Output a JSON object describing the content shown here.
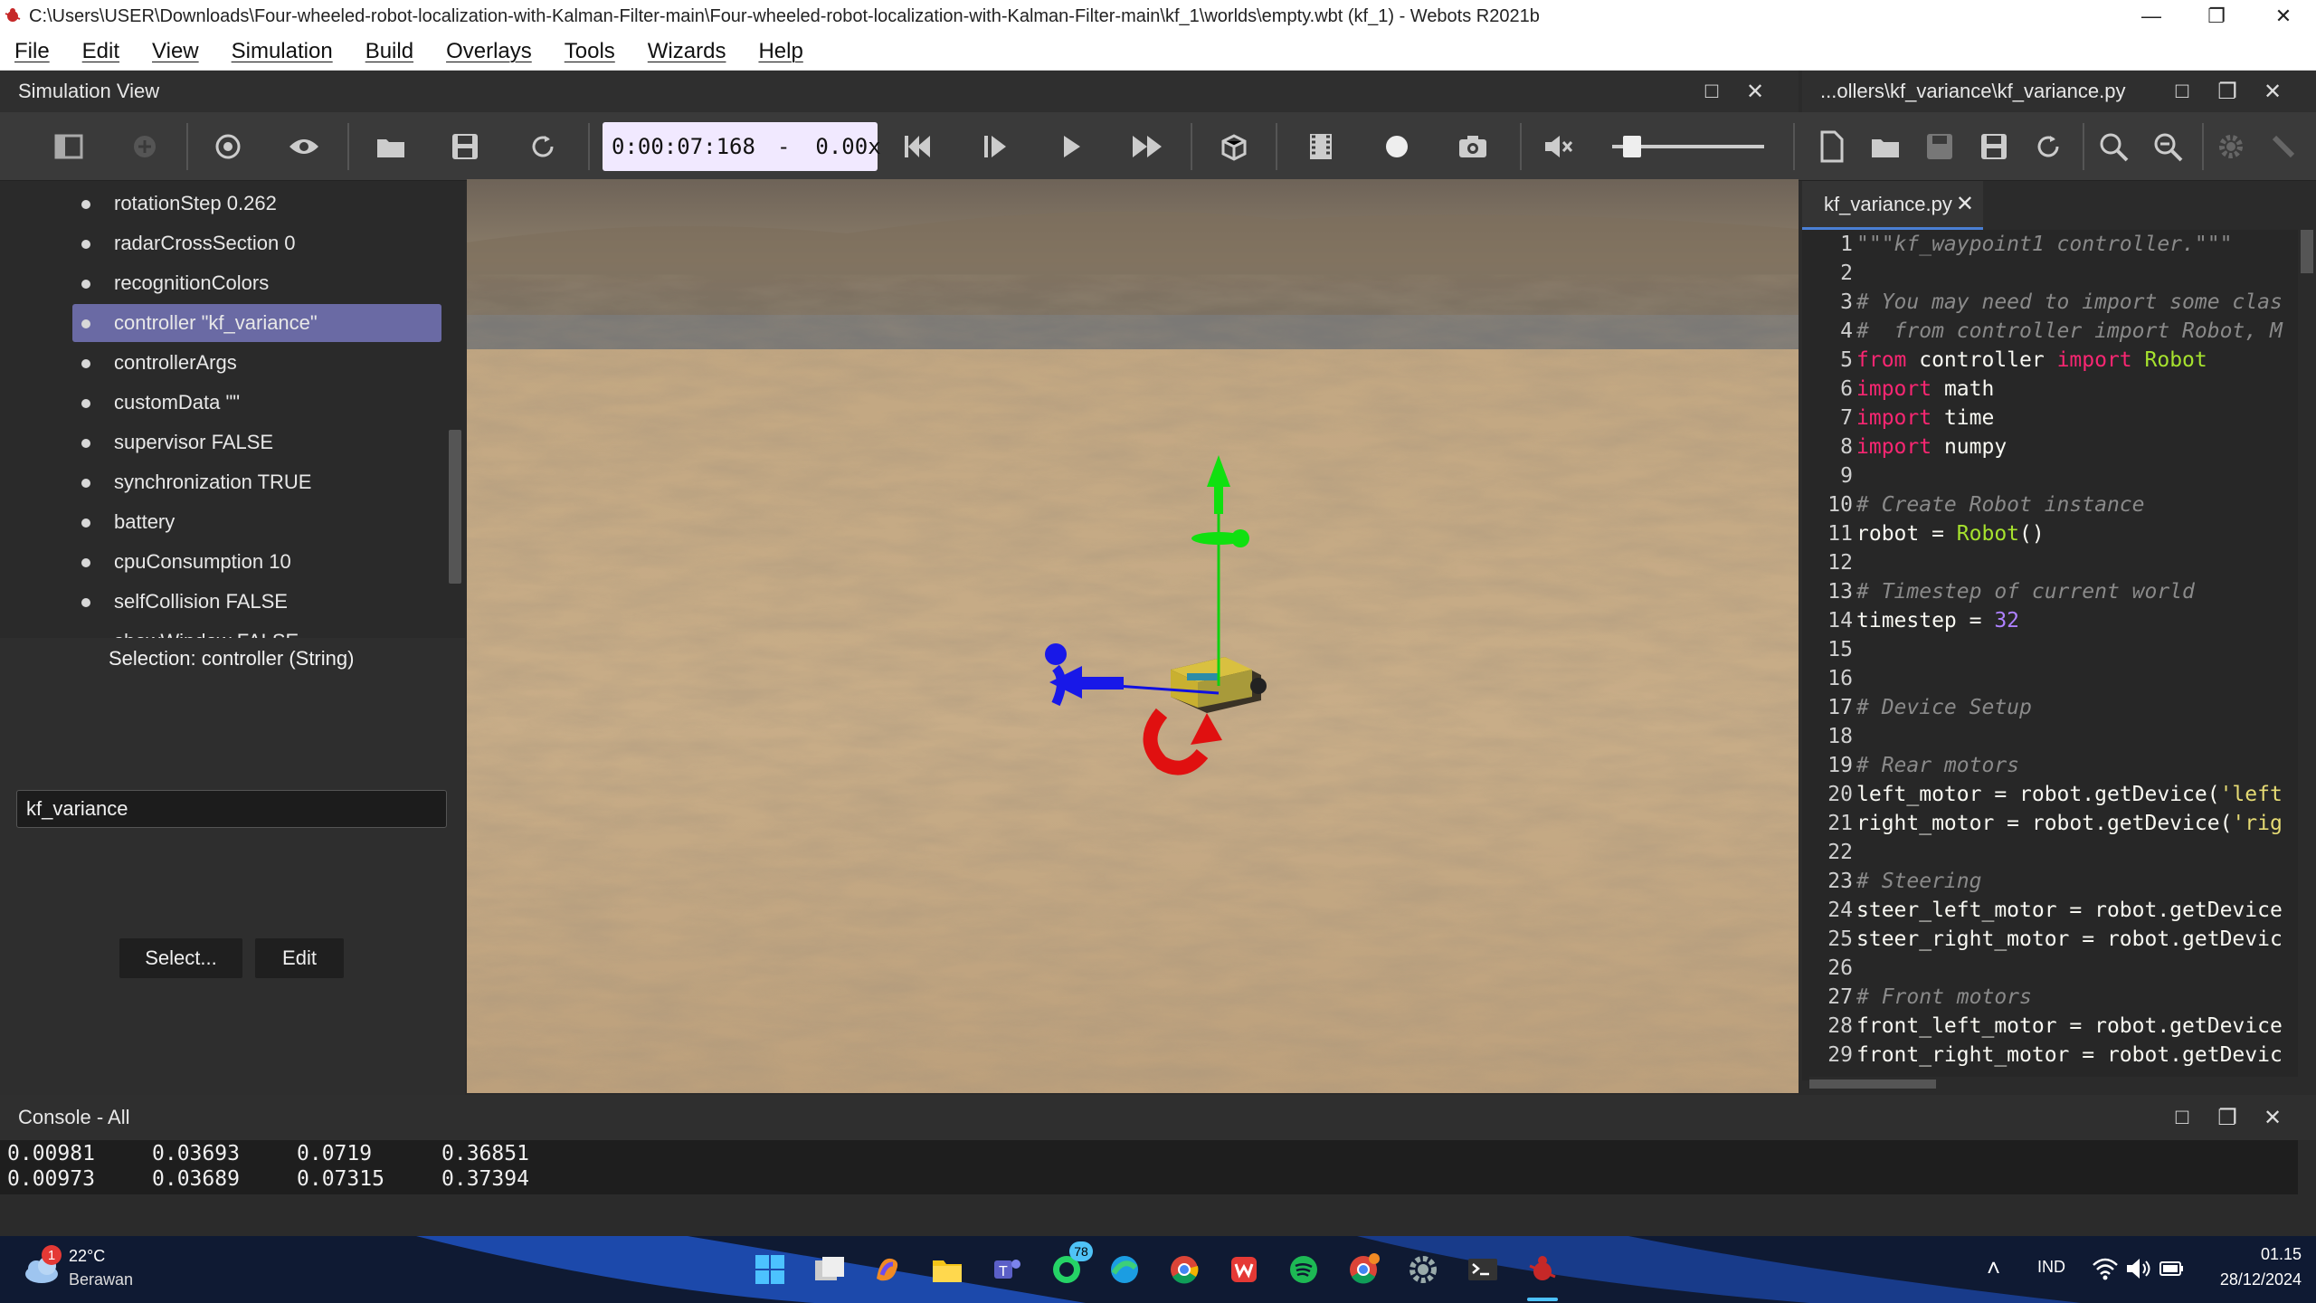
{
  "window": {
    "title": "C:\\Users\\USER\\Downloads\\Four-wheeled-robot-localization-with-Kalman-Filter-main\\Four-wheeled-robot-localization-with-Kalman-Filter-main\\kf_1\\worlds\\empty.wbt (kf_1) - Webots R2021b"
  },
  "menu": [
    "File",
    "Edit",
    "View",
    "Simulation",
    "Build",
    "Overlays",
    "Tools",
    "Wizards",
    "Help"
  ],
  "simulation_view": {
    "title": "Simulation View",
    "time": "0:00:07:168",
    "speed_sep": "-",
    "speed": "0.00x",
    "volume_fraction": 0.08
  },
  "scene_tree": {
    "items": [
      "rotationStep 0.262",
      "radarCrossSection 0",
      "recognitionColors",
      "controller \"kf_variance\"",
      "controllerArgs",
      "customData \"\"",
      "supervisor FALSE",
      "synchronization TRUE",
      "battery",
      "cpuConsumption 10",
      "selfCollision FALSE",
      "showWindow FALSE"
    ],
    "selected_index": 3
  },
  "field_editor": {
    "selection": "Selection: controller (String)",
    "value": "kf_variance",
    "select_label": "Select...",
    "edit_label": "Edit"
  },
  "editor": {
    "title": "...ollers\\kf_variance\\kf_variance.py",
    "tab": "kf_variance.py",
    "lines": [
      {
        "n": "1",
        "parts": [
          [
            "cm",
            "\"\"\"kf_waypoint1 controller.\"\"\""
          ]
        ]
      },
      {
        "n": "2",
        "parts": []
      },
      {
        "n": "3",
        "parts": [
          [
            "cm",
            "# You may need to import some clas"
          ]
        ]
      },
      {
        "n": "4",
        "parts": [
          [
            "cm",
            "#  from controller import Robot, M"
          ]
        ]
      },
      {
        "n": "5",
        "parts": [
          [
            "kw",
            "from"
          ],
          [
            "ct",
            " controller "
          ],
          [
            "kw",
            "import"
          ],
          [
            "fn",
            " Robot"
          ]
        ]
      },
      {
        "n": "6",
        "parts": [
          [
            "kw",
            "import"
          ],
          [
            "ct",
            " math"
          ]
        ]
      },
      {
        "n": "7",
        "parts": [
          [
            "kw",
            "import"
          ],
          [
            "ct",
            " time"
          ]
        ]
      },
      {
        "n": "8",
        "parts": [
          [
            "kw",
            "import"
          ],
          [
            "ct",
            " numpy"
          ]
        ]
      },
      {
        "n": "9",
        "parts": []
      },
      {
        "n": "10",
        "parts": [
          [
            "cm",
            "# Create Robot instance"
          ]
        ]
      },
      {
        "n": "11",
        "parts": [
          [
            "ct",
            "robot = "
          ],
          [
            "fn",
            "Robot"
          ],
          [
            "ct",
            "()"
          ]
        ]
      },
      {
        "n": "12",
        "parts": []
      },
      {
        "n": "13",
        "parts": [
          [
            "cm",
            "# Timestep of current world"
          ]
        ]
      },
      {
        "n": "14",
        "parts": [
          [
            "ct",
            "timestep = "
          ],
          [
            "num",
            "32"
          ]
        ]
      },
      {
        "n": "15",
        "parts": []
      },
      {
        "n": "16",
        "parts": []
      },
      {
        "n": "17",
        "parts": [
          [
            "cm",
            "# Device Setup"
          ]
        ]
      },
      {
        "n": "18",
        "parts": []
      },
      {
        "n": "19",
        "parts": [
          [
            "cm",
            "# Rear motors"
          ]
        ]
      },
      {
        "n": "20",
        "parts": [
          [
            "ct",
            "left_motor = robot.getDevice("
          ],
          [
            "str",
            "'left"
          ]
        ]
      },
      {
        "n": "21",
        "parts": [
          [
            "ct",
            "right_motor = robot.getDevice("
          ],
          [
            "str",
            "'rig"
          ]
        ]
      },
      {
        "n": "22",
        "parts": []
      },
      {
        "n": "23",
        "parts": [
          [
            "cm",
            "# Steering"
          ]
        ]
      },
      {
        "n": "24",
        "parts": [
          [
            "ct",
            "steer_left_motor = robot.getDevice"
          ]
        ]
      },
      {
        "n": "25",
        "parts": [
          [
            "ct",
            "steer_right_motor = robot.getDevic"
          ]
        ]
      },
      {
        "n": "26",
        "parts": []
      },
      {
        "n": "27",
        "parts": [
          [
            "cm",
            "# Front motors"
          ]
        ]
      },
      {
        "n": "28",
        "parts": [
          [
            "ct",
            "front_left_motor = robot.getDevice"
          ]
        ]
      },
      {
        "n": "29",
        "parts": [
          [
            "ct",
            "front_right_motor = robot.getDevic"
          ]
        ]
      }
    ]
  },
  "console": {
    "title": "Console - All",
    "rows": [
      [
        "0.00981",
        "0.03693",
        "0.0719",
        "0.36851"
      ],
      [
        "0.00973",
        "0.03689",
        "0.07315",
        "0.37394"
      ]
    ]
  },
  "taskbar": {
    "weather_temp": "22°C",
    "weather_desc": "Berawan",
    "weather_badge": "1",
    "whatsapp_badge": "78",
    "language": "IND",
    "time": "01.15",
    "date": "28/12/2024"
  },
  "colors": {
    "selection": "#6a6aa4",
    "timebox": "#f1e9ff",
    "axis_x": "#e01010",
    "axis_y": "#10e010",
    "axis_z": "#1010e0"
  }
}
